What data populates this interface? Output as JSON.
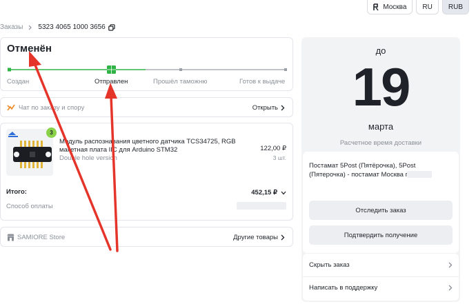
{
  "topbar": {
    "city": "Москва",
    "lang": "RU",
    "currency": "RUB"
  },
  "breadcrumb": {
    "root": "Заказы",
    "order_number": "5323 4065 1000 3656"
  },
  "status": {
    "title": "Отменён",
    "steps": [
      "Создан",
      "Отправлен",
      "Прошёл таможню",
      "Готов к выдаче"
    ],
    "current_step_index": 1,
    "colors": {
      "done": "#2fb344",
      "pending": "#8a8f98"
    }
  },
  "chat": {
    "label": "Чат по заказу и спору",
    "action": "Открыть"
  },
  "product": {
    "badge": "3",
    "name": "Модуль распознавания цветного датчика TCS34725, RGB макетная плата IIC для Arduino STM32",
    "variant": "Double hole version",
    "price": "122,00 ₽",
    "qty": "3 шт."
  },
  "totals": {
    "label": "Итого:",
    "value": "452,15 ₽",
    "payment_label": "Способ оплаты"
  },
  "store": {
    "name": "SAMIORE Store",
    "action": "Другие товары"
  },
  "delivery": {
    "until": "до",
    "day": "19",
    "month": "марта",
    "estimate_label": "Расчетное время доставки",
    "address": "Постамат 5Post (Пятёрочка), 5Post (Пятерочка) - постамат Москва г",
    "track_button": "Отследить заказ",
    "confirm_button": "Подтвердить получение",
    "hide_order": "Скрыть заказ",
    "support": "Написать в поддержку"
  },
  "annotation_color": "#e5352b"
}
